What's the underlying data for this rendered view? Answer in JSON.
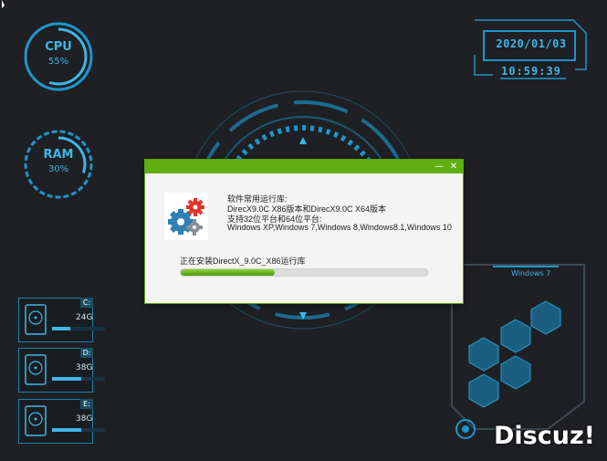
{
  "gauges": {
    "cpu": {
      "title": "CPU",
      "value": "55%",
      "percent": 55
    },
    "ram": {
      "title": "RAM",
      "value": "30%",
      "percent": 30
    }
  },
  "clock": {
    "date": "2020/01/03",
    "time": "10:59:39"
  },
  "disks": [
    {
      "drive": "C:",
      "size": "24G",
      "usage": 0.35
    },
    {
      "drive": "D:",
      "size": "38G",
      "usage": 0.55
    },
    {
      "drive": "E:",
      "size": "38G",
      "usage": 0.55
    }
  ],
  "dialog": {
    "minimize_icon": "minimize-icon",
    "close_icon": "close-icon",
    "lines": [
      "软件常用运行库:",
      "DirecX9.0C X86版本和DirecX9.0C X64版本",
      "支持32位平台和64位平台:",
      "Windows XP,Windows 7,Windows 8,Windows8.1,Windows 10"
    ],
    "status": "正在安装DirectX_9.0C_X86运行库",
    "progress": 0.38
  },
  "panel": {
    "label": "Windows 7"
  },
  "watermark": "Discuz!",
  "colors": {
    "accent": "#3fb6e8",
    "dialog_bar": "#61ae12",
    "background": "#1e2023"
  }
}
